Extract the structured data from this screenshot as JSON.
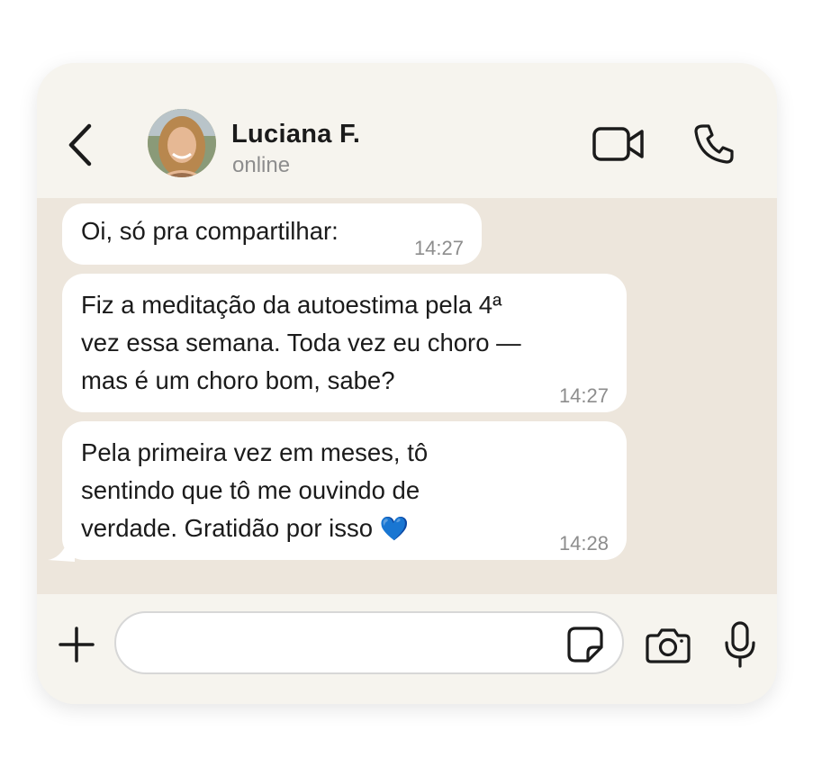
{
  "header": {
    "contact_name": "Luciana F.",
    "status": "online",
    "icons": [
      "back-arrow-icon",
      "video-call-icon",
      "phone-icon"
    ]
  },
  "messages": [
    {
      "text": "Oi, só pra compartilhar:",
      "time": "14:27"
    },
    {
      "text": "Fiz a meditação da autoestima pela 4ª\nvez essa semana. Toda vez eu choro —\nmas é um choro bom, sabe?",
      "time": "14:27"
    },
    {
      "text": "Pela primeira vez em meses, tô\nsentindo que tô me ouvindo de\nverdade. Gratidão por isso ",
      "emoji": "💙",
      "time": "14:28"
    }
  ],
  "input": {
    "value": "",
    "icons": [
      "plus-icon",
      "sticker-icon",
      "camera-icon",
      "microphone-icon"
    ]
  },
  "colors": {
    "background": "#f6f4ee",
    "chat_wallpaper": "#ede6dc",
    "bubble": "#ffffff",
    "text": "#1b1b1b",
    "muted": "#8d8d8d",
    "heart": "#2a7fd4"
  }
}
